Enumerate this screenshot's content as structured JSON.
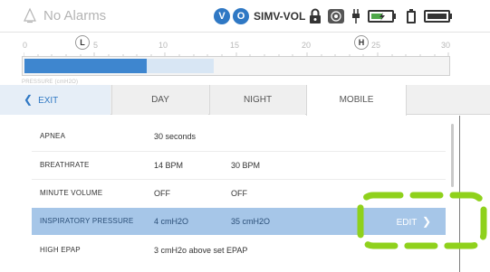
{
  "status": {
    "alarm_text": "No Alarms",
    "badge_v": "V",
    "badge_o": "O",
    "mode": "SIMV-VOL",
    "accent": "#2f78c4"
  },
  "scale": {
    "ticks": [
      "0",
      "5",
      "10",
      "15",
      "20",
      "25",
      "30"
    ],
    "low_marker": "L",
    "high_marker": "H",
    "label": "PRESSURE (cmH2O)"
  },
  "tabs": {
    "exit": "EXIT",
    "day": "DAY",
    "night": "NIGHT",
    "mobile": "MOBILE"
  },
  "settings": [
    {
      "name": "APNEA",
      "value1": "30 seconds",
      "value2": ""
    },
    {
      "name": "BREATHRATE",
      "value1": "14 BPM",
      "value2": "30 BPM"
    },
    {
      "name": "MINUTE VOLUME",
      "value1": "OFF",
      "value2": "OFF"
    },
    {
      "name": "INSPIRATORY PRESSURE",
      "value1": "4 cmH2O",
      "value2": "35 cmH2O"
    },
    {
      "name": "HIGH EPAP",
      "value1": "3 cmH2o above set EPAP",
      "value2": ""
    }
  ],
  "edit_label": "EDIT",
  "icons": [
    "bell-icon",
    "lock-icon",
    "touch-lock-icon",
    "plug-icon",
    "battery-charging-icon",
    "battery-icon",
    "battery-full-icon"
  ]
}
